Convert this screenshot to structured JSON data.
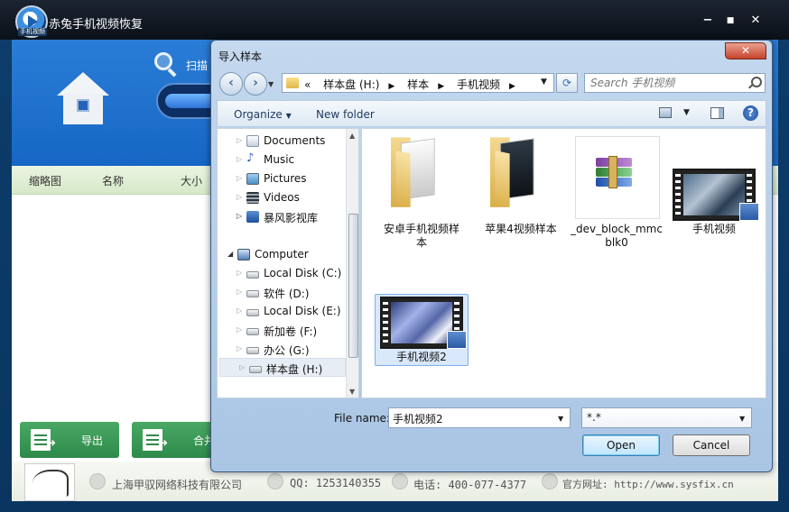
{
  "app": {
    "title": "赤兔手机视频恢复",
    "logo_caption": "手机视频",
    "window_controls": {
      "minimize": "−",
      "maximize": "■",
      "close": "✕"
    },
    "scan_label": "扫描",
    "columns": [
      "缩略图",
      "名称",
      "大小"
    ],
    "buttons": {
      "export": "导出",
      "merge": "合并"
    },
    "status": {
      "company": "上海甲驭网络科技有限公司",
      "qq": "QQ: 1253140355",
      "phone": "电话: 400-077-4377",
      "website": "官方网址: http://www.sysfix.cn"
    }
  },
  "dialog": {
    "title": "导入样本",
    "close_label": "✕",
    "back_label": "‹",
    "forward_label": "›",
    "address": {
      "overflow": "«",
      "crumbs": [
        "样本盘 (H:)",
        "样本",
        "手机视频"
      ]
    },
    "refresh_label": "⟳",
    "search_placeholder": "Search 手机视频",
    "organize_label": "Organize",
    "new_folder_label": "New folder",
    "help_label": "?",
    "tree": [
      {
        "label": "Documents",
        "icon": "documents-icon"
      },
      {
        "label": "Music",
        "icon": "music-icon"
      },
      {
        "label": "Pictures",
        "icon": "pictures-icon"
      },
      {
        "label": "Videos",
        "icon": "videos-icon"
      },
      {
        "label": "暴风影视库",
        "icon": "library-icon"
      },
      {
        "label": "Computer",
        "icon": "computer-icon"
      },
      {
        "label": "Local Disk (C:)",
        "icon": "drive-icon"
      },
      {
        "label": "软件 (D:)",
        "icon": "drive-icon"
      },
      {
        "label": "Local Disk (E:)",
        "icon": "drive-icon"
      },
      {
        "label": "新加卷 (F:)",
        "icon": "drive-icon"
      },
      {
        "label": "办公 (G:)",
        "icon": "drive-icon"
      },
      {
        "label": "样本盘 (H:)",
        "icon": "drive-icon",
        "selected": true
      }
    ],
    "files": [
      {
        "line1": "安卓手机视频样",
        "line2": "本",
        "kind": "folder"
      },
      {
        "line1": "苹果4视频样本",
        "line2": "",
        "kind": "folder-dark"
      },
      {
        "line1": "_dev_block_mmc",
        "line2": "blk0",
        "kind": "archive"
      },
      {
        "line1": "手机视频",
        "line2": "",
        "kind": "video"
      },
      {
        "line1": "手机视频2",
        "line2": "",
        "kind": "video",
        "selected": true
      }
    ],
    "file_name_label": "File name:",
    "file_name_value": "手机视频2",
    "filter_value": "*.*",
    "open_label": "Open",
    "cancel_label": "Cancel"
  }
}
